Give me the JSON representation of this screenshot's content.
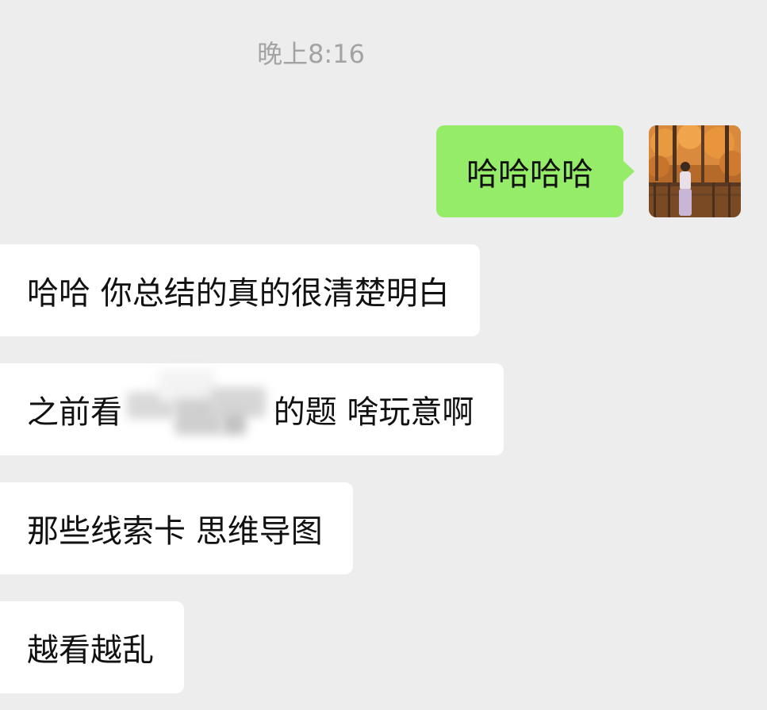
{
  "chat": {
    "timestamp": "晚上8:16",
    "self_message": "哈哈哈哈",
    "messages": [
      "哈哈 你总结的真的很清楚明白",
      "之前看               的题 啥玩意啊",
      "那些线索卡 思维导图",
      "越看越乱"
    ]
  },
  "colors": {
    "background": "#ededed",
    "self_bubble": "#95ec69",
    "other_bubble": "#ffffff",
    "timestamp_text": "#a3a3a3"
  },
  "icons": {
    "avatar": "avatar-photo"
  }
}
